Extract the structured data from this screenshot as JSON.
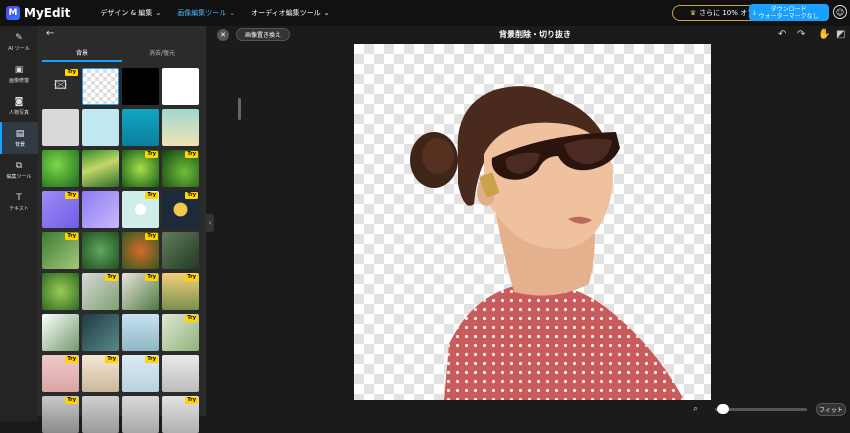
{
  "app": {
    "name": "MyEdit",
    "logo_letter": "M"
  },
  "nav": [
    {
      "label": "デザイン & 編集",
      "active": false
    },
    {
      "label": "画像編集ツール",
      "active": true
    },
    {
      "label": "オーディオ編集ツール",
      "active": false
    }
  ],
  "header": {
    "promo_label": "さらに 10% オフ",
    "download_line1": "ダウンロード",
    "download_line2": "ウォーターマークなし"
  },
  "rail": [
    {
      "label": "AI ツール",
      "icon": "magic-wand-icon",
      "glyph": "✎"
    },
    {
      "label": "画像修復",
      "icon": "image-repair-icon",
      "glyph": "▣"
    },
    {
      "label": "人物写真",
      "icon": "portrait-icon",
      "glyph": "◙"
    },
    {
      "label": "背景",
      "icon": "background-icon",
      "glyph": "▤",
      "active": true
    },
    {
      "label": "編集ツール",
      "icon": "edit-tools-icon",
      "glyph": "⧉"
    },
    {
      "label": "テキスト",
      "icon": "text-icon",
      "glyph": "T"
    }
  ],
  "panel": {
    "tabs": [
      {
        "label": "背景",
        "active": true
      },
      {
        "label": "消去/復元",
        "active": false
      }
    ],
    "try_label": "Try",
    "tiles": [
      {
        "kind": "upload",
        "try": true,
        "bg": ""
      },
      {
        "kind": "transparent",
        "try": false,
        "bg": ""
      },
      {
        "kind": "color",
        "try": false,
        "bg": "#000000"
      },
      {
        "kind": "color",
        "try": false,
        "bg": "#ffffff"
      },
      {
        "kind": "color",
        "try": false,
        "bg": "#d9d9d9"
      },
      {
        "kind": "color",
        "try": false,
        "bg": "#bfe8f0"
      },
      {
        "kind": "color",
        "try": false,
        "bg": "linear-gradient(180deg,#11a6c4,#0b7f9a)"
      },
      {
        "kind": "color",
        "try": false,
        "bg": "linear-gradient(180deg,#9fd8d0,#f1e3b5)"
      },
      {
        "kind": "image",
        "try": false,
        "bg": "radial-gradient(circle at 40% 40%,#7fd84a,#1c6b1c)"
      },
      {
        "kind": "image",
        "try": false,
        "bg": "linear-gradient(160deg,#2f8a2a,#c3d86a 45%,#2a6d2a)"
      },
      {
        "kind": "image",
        "try": true,
        "bg": "radial-gradient(circle,#a7e04c,#155a16)"
      },
      {
        "kind": "image",
        "try": true,
        "bg": "radial-gradient(circle at 60% 60%,#6fbf3a,#0f3e10)"
      },
      {
        "kind": "image",
        "try": true,
        "bg": "linear-gradient(135deg,#9e8cf5,#6f5ce8)"
      },
      {
        "kind": "image",
        "try": false,
        "bg": "linear-gradient(135deg,#8c7cf0,#c9b8ff)"
      },
      {
        "kind": "image",
        "try": true,
        "bg": "radial-gradient(circle,#ffffff 20%,#cfeeea 22%)"
      },
      {
        "kind": "image",
        "try": true,
        "bg": "radial-gradient(circle,#f2c94c 25%,#1d2a3a 28%)"
      },
      {
        "kind": "image",
        "try": true,
        "bg": "linear-gradient(135deg,#3f7a34,#a3c97a)"
      },
      {
        "kind": "image",
        "try": false,
        "bg": "radial-gradient(circle,#5fa85c,#1f4f21)"
      },
      {
        "kind": "image",
        "try": true,
        "bg": "radial-gradient(circle,#d86a2a,#2f5a22)"
      },
      {
        "kind": "image",
        "try": false,
        "bg": "linear-gradient(135deg,#5f7f5a,#243824)"
      },
      {
        "kind": "image",
        "try": false,
        "bg": "radial-gradient(circle,#9acd5a,#2d6a1f)"
      },
      {
        "kind": "image",
        "try": true,
        "bg": "linear-gradient(135deg,#d8d8d8,#7ea070)"
      },
      {
        "kind": "image",
        "try": true,
        "bg": "linear-gradient(135deg,#e8e4de,#4f7a3f)"
      },
      {
        "kind": "image",
        "try": true,
        "bg": "linear-gradient(180deg,#f3cf7a,#7a8f4f)"
      },
      {
        "kind": "image",
        "try": false,
        "bg": "linear-gradient(135deg,#ffffff,#6f9a6a)"
      },
      {
        "kind": "image",
        "try": false,
        "bg": "linear-gradient(135deg,#1f3a44,#5a8a86)"
      },
      {
        "kind": "image",
        "try": false,
        "bg": "linear-gradient(180deg,#c7e3f2,#8fb6c4)"
      },
      {
        "kind": "image",
        "try": true,
        "bg": "linear-gradient(135deg,#dfe8d2,#8fb27a)"
      },
      {
        "kind": "image",
        "try": true,
        "bg": "linear-gradient(180deg,#f0c9c9,#d9a5a5)"
      },
      {
        "kind": "image",
        "try": true,
        "bg": "linear-gradient(180deg,#f3e7d6,#cdb79a)"
      },
      {
        "kind": "image",
        "try": true,
        "bg": "linear-gradient(180deg,#dcebf2,#b7d2e0)"
      },
      {
        "kind": "image",
        "try": false,
        "bg": "linear-gradient(180deg,#eaeaea,#bcbcbc)"
      },
      {
        "kind": "image",
        "try": true,
        "bg": "linear-gradient(180deg,#c9c9c9,#8a8a8a)"
      },
      {
        "kind": "image",
        "try": false,
        "bg": "linear-gradient(180deg,#cfcfcf,#9a9a9a)"
      },
      {
        "kind": "image",
        "try": false,
        "bg": "linear-gradient(180deg,#d9d9d9,#a8a8a8)"
      },
      {
        "kind": "image",
        "try": true,
        "bg": "linear-gradient(180deg,#e3e3e3,#b0b0b0)"
      }
    ]
  },
  "workspace": {
    "replace_label": "画像置き換え",
    "title": "背景削除・切り抜き",
    "fit_label": "フィット",
    "zoom_level": 0.05
  },
  "colors": {
    "accent": "#1aa0ff",
    "try_badge": "#ffd400",
    "dress": "#c85b5b"
  }
}
